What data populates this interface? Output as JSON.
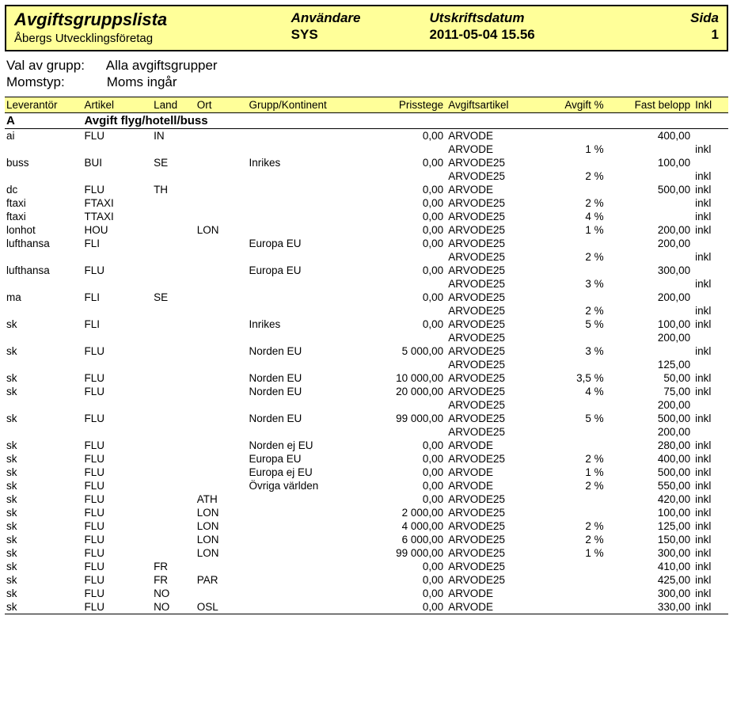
{
  "header": {
    "title": "Avgiftsgruppslista",
    "company": "Åbergs Utvecklingsföretag",
    "user_label": "Användare",
    "user_value": "SYS",
    "date_label": "Utskriftsdatum",
    "date_value": "2011-05-04 15.56",
    "page_label": "Sida",
    "page_value": "1"
  },
  "filters": {
    "group_label": "Val av grupp:",
    "group_value": "Alla avgiftsgrupper",
    "vat_label": "Momstyp:",
    "vat_value": "Moms ingår"
  },
  "columns": {
    "lev": "Leverantör",
    "art": "Artikel",
    "land": "Land",
    "ort": "Ort",
    "grp": "Grupp/Kontinent",
    "pris": "Prisstege",
    "aart": "Avgiftsartikel",
    "avg": "Avgift %",
    "fast": "Fast belopp",
    "inkl": "Inkl"
  },
  "group": {
    "code": "A",
    "name": "Avgift flyg/hotell/buss"
  },
  "rows": [
    {
      "lev": "ai",
      "art": "FLU",
      "land": "IN",
      "ort": "",
      "grp": "",
      "pris": "0,00",
      "aart": "ARVODE",
      "avg": "",
      "fast": "400,00",
      "inkl": ""
    },
    {
      "lev": "",
      "art": "",
      "land": "",
      "ort": "",
      "grp": "",
      "pris": "",
      "aart": "ARVODE",
      "avg": "1 %",
      "fast": "",
      "inkl": "inkl"
    },
    {
      "lev": "buss",
      "art": "BUI",
      "land": "SE",
      "ort": "",
      "grp": "Inrikes",
      "pris": "0,00",
      "aart": "ARVODE25",
      "avg": "",
      "fast": "100,00",
      "inkl": ""
    },
    {
      "lev": "",
      "art": "",
      "land": "",
      "ort": "",
      "grp": "",
      "pris": "",
      "aart": "ARVODE25",
      "avg": "2 %",
      "fast": "",
      "inkl": "inkl"
    },
    {
      "lev": "dc",
      "art": "FLU",
      "land": "TH",
      "ort": "",
      "grp": "",
      "pris": "0,00",
      "aart": "ARVODE",
      "avg": "",
      "fast": "500,00",
      "inkl": "inkl"
    },
    {
      "lev": "ftaxi",
      "art": "FTAXI",
      "land": "",
      "ort": "",
      "grp": "",
      "pris": "0,00",
      "aart": "ARVODE25",
      "avg": "2 %",
      "fast": "",
      "inkl": "inkl"
    },
    {
      "lev": "ftaxi",
      "art": "TTAXI",
      "land": "",
      "ort": "",
      "grp": "",
      "pris": "0,00",
      "aart": "ARVODE25",
      "avg": "4 %",
      "fast": "",
      "inkl": "inkl"
    },
    {
      "lev": "lonhot",
      "art": "HOU",
      "land": "",
      "ort": "LON",
      "grp": "",
      "pris": "0,00",
      "aart": "ARVODE25",
      "avg": "1 %",
      "fast": "200,00",
      "inkl": "inkl"
    },
    {
      "lev": "lufthansa",
      "art": "FLI",
      "land": "",
      "ort": "",
      "grp": "Europa EU",
      "pris": "0,00",
      "aart": "ARVODE25",
      "avg": "",
      "fast": "200,00",
      "inkl": ""
    },
    {
      "lev": "",
      "art": "",
      "land": "",
      "ort": "",
      "grp": "",
      "pris": "",
      "aart": "ARVODE25",
      "avg": "2 %",
      "fast": "",
      "inkl": "inkl"
    },
    {
      "lev": "lufthansa",
      "art": "FLU",
      "land": "",
      "ort": "",
      "grp": "Europa EU",
      "pris": "0,00",
      "aart": "ARVODE25",
      "avg": "",
      "fast": "300,00",
      "inkl": ""
    },
    {
      "lev": "",
      "art": "",
      "land": "",
      "ort": "",
      "grp": "",
      "pris": "",
      "aart": "ARVODE25",
      "avg": "3 %",
      "fast": "",
      "inkl": "inkl"
    },
    {
      "lev": "ma",
      "art": "FLI",
      "land": "SE",
      "ort": "",
      "grp": "",
      "pris": "0,00",
      "aart": "ARVODE25",
      "avg": "",
      "fast": "200,00",
      "inkl": ""
    },
    {
      "lev": "",
      "art": "",
      "land": "",
      "ort": "",
      "grp": "",
      "pris": "",
      "aart": "ARVODE25",
      "avg": "2 %",
      "fast": "",
      "inkl": "inkl"
    },
    {
      "lev": "sk",
      "art": "FLI",
      "land": "",
      "ort": "",
      "grp": "Inrikes",
      "pris": "0,00",
      "aart": "ARVODE25",
      "avg": "5 %",
      "fast": "100,00",
      "inkl": "inkl"
    },
    {
      "lev": "",
      "art": "",
      "land": "",
      "ort": "",
      "grp": "",
      "pris": "",
      "aart": "ARVODE25",
      "avg": "",
      "fast": "200,00",
      "inkl": ""
    },
    {
      "lev": "sk",
      "art": "FLU",
      "land": "",
      "ort": "",
      "grp": "Norden EU",
      "pris": "5 000,00",
      "aart": "ARVODE25",
      "avg": "3 %",
      "fast": "",
      "inkl": "inkl"
    },
    {
      "lev": "",
      "art": "",
      "land": "",
      "ort": "",
      "grp": "",
      "pris": "",
      "aart": "ARVODE25",
      "avg": "",
      "fast": "125,00",
      "inkl": ""
    },
    {
      "lev": "sk",
      "art": "FLU",
      "land": "",
      "ort": "",
      "grp": "Norden EU",
      "pris": "10 000,00",
      "aart": "ARVODE25",
      "avg": "3,5 %",
      "fast": "50,00",
      "inkl": "inkl"
    },
    {
      "lev": "sk",
      "art": "FLU",
      "land": "",
      "ort": "",
      "grp": "Norden EU",
      "pris": "20 000,00",
      "aart": "ARVODE25",
      "avg": "4 %",
      "fast": "75,00",
      "inkl": "inkl"
    },
    {
      "lev": "",
      "art": "",
      "land": "",
      "ort": "",
      "grp": "",
      "pris": "",
      "aart": "ARVODE25",
      "avg": "",
      "fast": "200,00",
      "inkl": ""
    },
    {
      "lev": "sk",
      "art": "FLU",
      "land": "",
      "ort": "",
      "grp": "Norden EU",
      "pris": "99 000,00",
      "aart": "ARVODE25",
      "avg": "5 %",
      "fast": "500,00",
      "inkl": "inkl"
    },
    {
      "lev": "",
      "art": "",
      "land": "",
      "ort": "",
      "grp": "",
      "pris": "",
      "aart": "ARVODE25",
      "avg": "",
      "fast": "200,00",
      "inkl": ""
    },
    {
      "lev": "sk",
      "art": "FLU",
      "land": "",
      "ort": "",
      "grp": "Norden ej EU",
      "pris": "0,00",
      "aart": "ARVODE",
      "avg": "",
      "fast": "280,00",
      "inkl": "inkl"
    },
    {
      "lev": "sk",
      "art": "FLU",
      "land": "",
      "ort": "",
      "grp": "Europa EU",
      "pris": "0,00",
      "aart": "ARVODE25",
      "avg": "2 %",
      "fast": "400,00",
      "inkl": "inkl"
    },
    {
      "lev": "sk",
      "art": "FLU",
      "land": "",
      "ort": "",
      "grp": "Europa ej EU",
      "pris": "0,00",
      "aart": "ARVODE",
      "avg": "1 %",
      "fast": "500,00",
      "inkl": "inkl"
    },
    {
      "lev": "sk",
      "art": "FLU",
      "land": "",
      "ort": "",
      "grp": "Övriga världen",
      "pris": "0,00",
      "aart": "ARVODE",
      "avg": "2 %",
      "fast": "550,00",
      "inkl": "inkl"
    },
    {
      "lev": "sk",
      "art": "FLU",
      "land": "",
      "ort": "ATH",
      "grp": "",
      "pris": "0,00",
      "aart": "ARVODE25",
      "avg": "",
      "fast": "420,00",
      "inkl": "inkl"
    },
    {
      "lev": "sk",
      "art": "FLU",
      "land": "",
      "ort": "LON",
      "grp": "",
      "pris": "2 000,00",
      "aart": "ARVODE25",
      "avg": "",
      "fast": "100,00",
      "inkl": "inkl"
    },
    {
      "lev": "sk",
      "art": "FLU",
      "land": "",
      "ort": "LON",
      "grp": "",
      "pris": "4 000,00",
      "aart": "ARVODE25",
      "avg": "2 %",
      "fast": "125,00",
      "inkl": "inkl"
    },
    {
      "lev": "sk",
      "art": "FLU",
      "land": "",
      "ort": "LON",
      "grp": "",
      "pris": "6 000,00",
      "aart": "ARVODE25",
      "avg": "2 %",
      "fast": "150,00",
      "inkl": "inkl"
    },
    {
      "lev": "sk",
      "art": "FLU",
      "land": "",
      "ort": "LON",
      "grp": "",
      "pris": "99 000,00",
      "aart": "ARVODE25",
      "avg": "1 %",
      "fast": "300,00",
      "inkl": "inkl"
    },
    {
      "lev": "sk",
      "art": "FLU",
      "land": "FR",
      "ort": "",
      "grp": "",
      "pris": "0,00",
      "aart": "ARVODE25",
      "avg": "",
      "fast": "410,00",
      "inkl": "inkl"
    },
    {
      "lev": "sk",
      "art": "FLU",
      "land": "FR",
      "ort": "PAR",
      "grp": "",
      "pris": "0,00",
      "aart": "ARVODE25",
      "avg": "",
      "fast": "425,00",
      "inkl": "inkl"
    },
    {
      "lev": "sk",
      "art": "FLU",
      "land": "NO",
      "ort": "",
      "grp": "",
      "pris": "0,00",
      "aart": "ARVODE",
      "avg": "",
      "fast": "300,00",
      "inkl": "inkl"
    },
    {
      "lev": "sk",
      "art": "FLU",
      "land": "NO",
      "ort": "OSL",
      "grp": "",
      "pris": "0,00",
      "aart": "ARVODE",
      "avg": "",
      "fast": "330,00",
      "inkl": "inkl"
    }
  ]
}
